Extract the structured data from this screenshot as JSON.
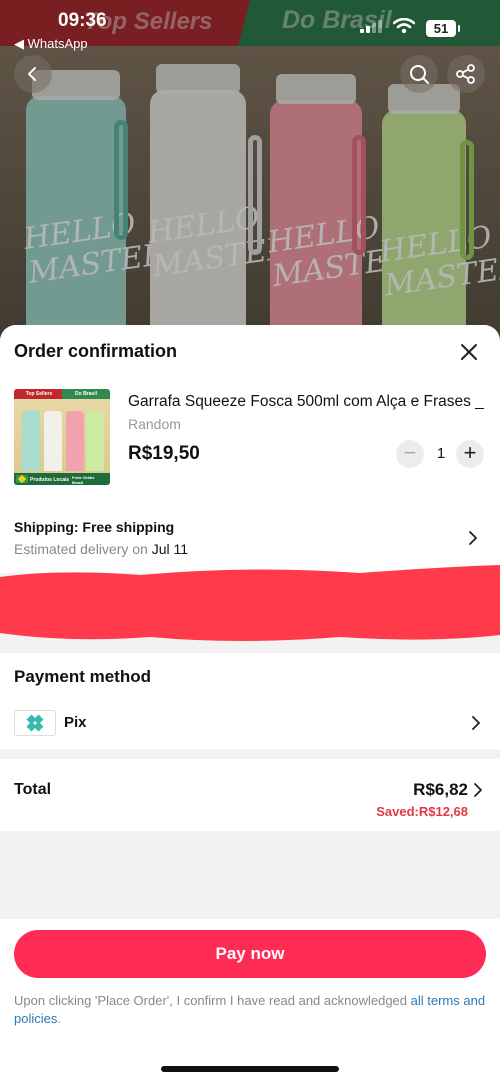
{
  "status_bar": {
    "time": "09:36",
    "back_app": "◀ WhatsApp",
    "battery": "51"
  },
  "hero": {
    "banner_left": "Top Sellers",
    "banner_right": "Do Brasil",
    "bottle_text": "HELLO MASTER",
    "bottle_colors": [
      "#9fd6c9",
      "#e8e6e0",
      "#f19aa5",
      "#c7e79a"
    ]
  },
  "sheet": {
    "title": "Order confirmation",
    "product": {
      "name": "Garrafa Squeeze Fosca 500ml com Alça e Frases _",
      "variant": "Random",
      "price": "R$19,50",
      "quantity": "1",
      "thumb_banner_left": "Top Sellers",
      "thumb_banner_right": "Do Brasil",
      "thumb_footer_left": "Produtos Locais",
      "thumb_footer_right": "Frete Grátis Brasil"
    },
    "shipping": {
      "title": "Shipping: Free shipping",
      "estimate_prefix": "Estimated delivery on ",
      "estimate_date": "Jul 11"
    },
    "payment": {
      "title": "Payment method",
      "method": "Pix"
    },
    "total": {
      "label": "Total",
      "value": "R$6,82",
      "saved": "Saved:R$12,68"
    },
    "pay_button": "Pay now",
    "terms": {
      "text": "Upon clicking 'Place Order', I confirm I have read and acknowledged ",
      "link": "all terms and policies",
      "end": "."
    }
  },
  "colors": {
    "accent": "#fe2c55",
    "saved": "#e23a44",
    "pix": "#32bcad",
    "link": "#2a7ab8",
    "redaction": "#ff3b4b"
  },
  "icons": [
    "back-icon",
    "search-icon",
    "share-icon",
    "close-icon",
    "minus-icon",
    "plus-icon",
    "chevron-right-icon",
    "pix-icon"
  ]
}
